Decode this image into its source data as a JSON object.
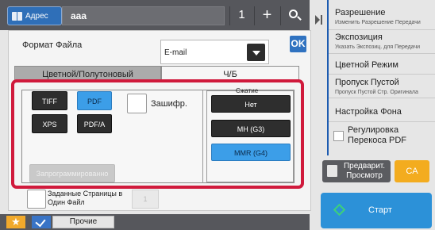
{
  "header": {
    "address_label": "Адрес",
    "address_value": "ааа",
    "count": "1",
    "plus_symbol": "+",
    "search_icon": "search-icon"
  },
  "file_format": {
    "label": "Формат Файла",
    "selected": "E-mail",
    "ok_label": "OK"
  },
  "tabs": [
    {
      "label": "Цветной/Полутоновый",
      "active": false
    },
    {
      "label": "Ч/Б",
      "active": true
    }
  ],
  "formats": {
    "tiff": "TIFF",
    "pdf": "PDF",
    "xps": "XPS",
    "pdfa": "PDF/A",
    "selected": "PDF",
    "programmed": "Запрограммированно"
  },
  "encryption": {
    "label": "Зашифр.",
    "checked": false
  },
  "compression": {
    "title": "Сжатие",
    "options": [
      "Нет",
      "MH (G3)",
      "MMR (G4)"
    ],
    "selected": "MMR (G4)"
  },
  "pages_per_file": {
    "label": "Заданные Страницы в Один Файл",
    "checked": false,
    "value": "1"
  },
  "bottom": {
    "other_label": "Прочие",
    "star_icon": "star-icon",
    "check_icon": "checkmark-icon"
  },
  "right_panel": {
    "items": [
      {
        "title": "Разрешение",
        "subtitle": "Изменить Разрешение Передачи"
      },
      {
        "title": "Экспозиция",
        "subtitle": "Указать Экспозиц. для Передачи"
      },
      {
        "title": "Цветной Режим",
        "subtitle": ""
      },
      {
        "title": "Пропуск Пустой",
        "subtitle": "Пропуск Пустой Стр. Оригинала"
      },
      {
        "title": "Настройка Фона",
        "subtitle": ""
      },
      {
        "title": "Регулировка Перекоса PDF",
        "subtitle": ""
      }
    ],
    "preview_label": "Предварит. Просмотр",
    "ca_label": "CA",
    "start_label": "Старт"
  },
  "colors": {
    "highlight": "#d01a3c",
    "selected_button": "#3c9ee8",
    "accent": "#2f72c0",
    "ca": "#f3ac1f",
    "start": "#2c91d8"
  }
}
